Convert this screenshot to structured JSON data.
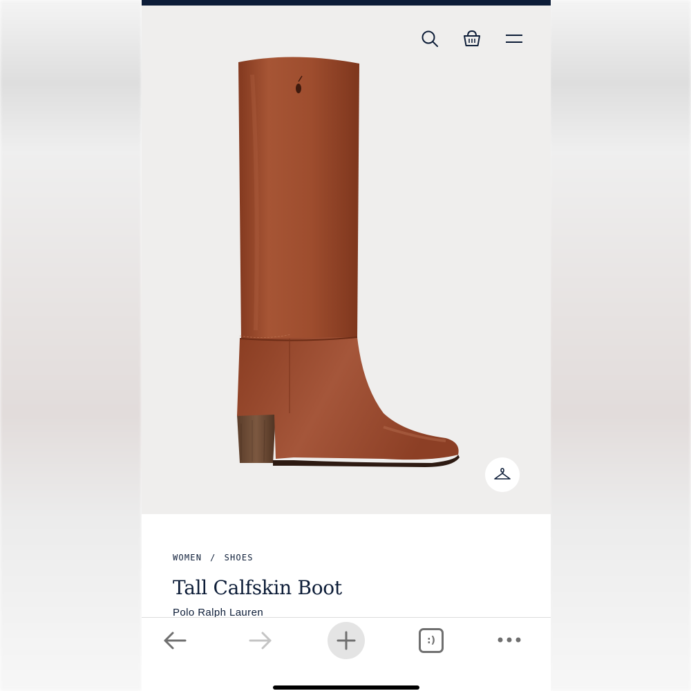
{
  "colors": {
    "navy": "#0c1c37",
    "hero_bg": "#efeeed",
    "leather": "#9c4e32",
    "icon_gray": "#6f6f6f",
    "icon_light": "#c4c4c4"
  },
  "header": {
    "icons": [
      "search-icon",
      "shopping-bag-icon",
      "menu-icon"
    ]
  },
  "product": {
    "image_alt": "tall brown leather boot",
    "breadcrumb": [
      "WOMEN",
      "/",
      "SHOES"
    ],
    "title": "Tall Calfskin Boot",
    "brand": "Polo Ralph Lauren",
    "hanger_icon": "hanger-icon"
  },
  "browser_toolbar": {
    "icons": [
      "back-arrow-icon",
      "forward-arrow-icon",
      "new-tab-plus-icon",
      "tabs-icon",
      "more-icon"
    ],
    "tabs_label": ":)"
  }
}
